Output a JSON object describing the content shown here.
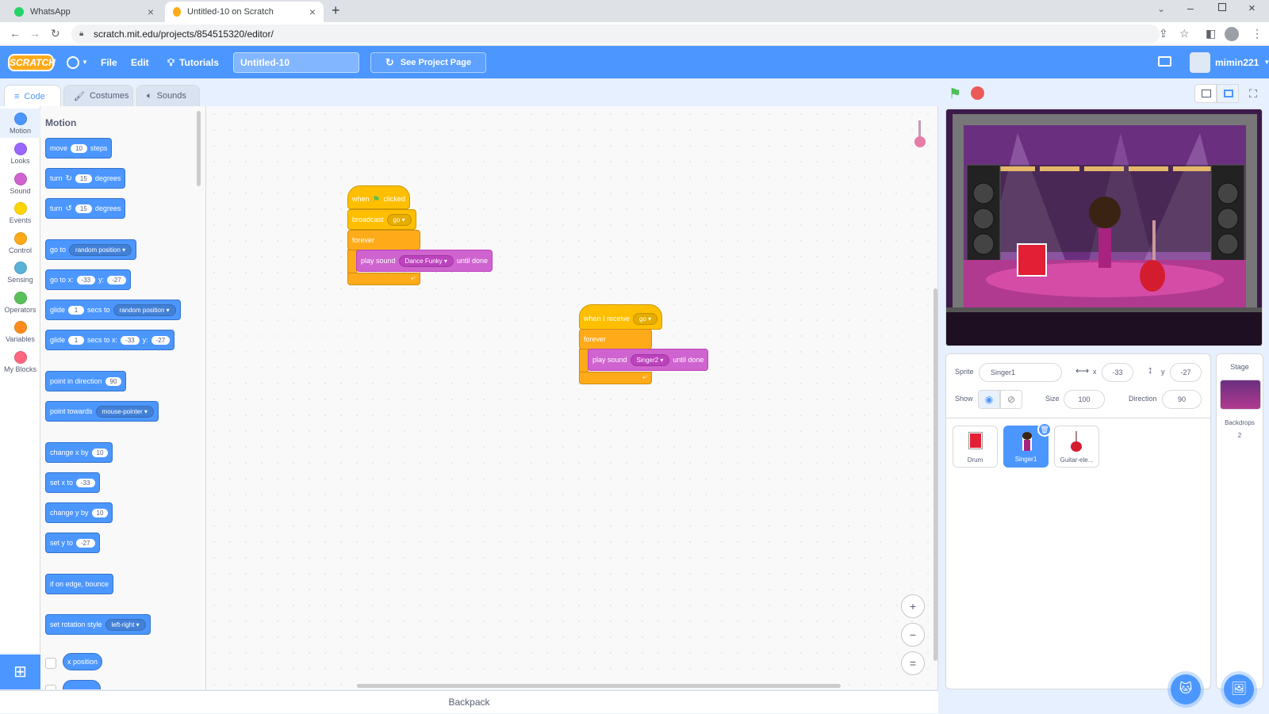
{
  "browser": {
    "tabs": [
      {
        "title": "WhatsApp",
        "active": false
      },
      {
        "title": "Untitled-10 on Scratch",
        "active": true
      }
    ],
    "new_tab": "+",
    "url": "scratch.mit.edu/projects/854515320/editor/"
  },
  "menubar": {
    "logo": "SCRATCH",
    "file": "File",
    "edit": "Edit",
    "tutorials": "Tutorials",
    "project_title": "Untitled-10",
    "see_project_page": "See Project Page",
    "username": "mimin221"
  },
  "editor_tabs": [
    "Code",
    "Costumes",
    "Sounds"
  ],
  "categories": [
    {
      "label": "Motion",
      "color": "#4c97ff"
    },
    {
      "label": "Looks",
      "color": "#9966ff"
    },
    {
      "label": "Sound",
      "color": "#cf63cf"
    },
    {
      "label": "Events",
      "color": "#ffd500"
    },
    {
      "label": "Control",
      "color": "#ffab19"
    },
    {
      "label": "Sensing",
      "color": "#5cb1d6"
    },
    {
      "label": "Operators",
      "color": "#59c059"
    },
    {
      "label": "Variables",
      "color": "#ff8c1a"
    },
    {
      "label": "My Blocks",
      "color": "#ff6680"
    }
  ],
  "palette": {
    "heading": "Motion",
    "move": {
      "pre": "move",
      "val": "10",
      "post": "steps"
    },
    "turn_cw": {
      "pre": "turn",
      "val": "15",
      "post": "degrees"
    },
    "turn_ccw": {
      "pre": "turn",
      "val": "15",
      "post": "degrees"
    },
    "goto": {
      "pre": "go to",
      "dd": "random position"
    },
    "gotoxy": {
      "pre": "go to x:",
      "x": "-33",
      "mid": "y:",
      "y": "-27"
    },
    "glide": {
      "pre": "glide",
      "val": "1",
      "mid": "secs to",
      "dd": "random position"
    },
    "glidexy": {
      "pre": "glide",
      "val": "1",
      "mid": "secs to x:",
      "x": "-33",
      "mid2": "y:",
      "y": "-27"
    },
    "point_dir": {
      "pre": "point in direction",
      "val": "90"
    },
    "point_towards": {
      "pre": "point towards",
      "dd": "mouse-pointer"
    },
    "change_x": {
      "pre": "change x by",
      "val": "10"
    },
    "set_x": {
      "pre": "set x to",
      "val": "-33"
    },
    "change_y": {
      "pre": "change y by",
      "val": "10"
    },
    "set_y": {
      "pre": "set y to",
      "val": "-27"
    },
    "bounce": "if on edge, bounce",
    "rotation": {
      "pre": "set rotation style",
      "dd": "left-right"
    },
    "x_position": "x position"
  },
  "scripts": {
    "script1": {
      "hat": {
        "pre": "when",
        "post": "clicked"
      },
      "broadcast": {
        "pre": "broadcast",
        "dd": "go"
      },
      "forever": "forever",
      "play": {
        "pre": "play sound",
        "dd": "Dance Funky",
        "post": "until done"
      }
    },
    "script2": {
      "hat": {
        "pre": "when I receive",
        "dd": "go"
      },
      "forever": "forever",
      "play": {
        "pre": "play sound",
        "dd": "Singer2",
        "post": "until done"
      }
    }
  },
  "zoom": {
    "in": "+",
    "out": "−",
    "reset": "="
  },
  "backpack": "Backpack",
  "sprite_info": {
    "sprite_label": "Sprite",
    "sprite_name": "Singer1",
    "x_label": "x",
    "x": "-33",
    "y_label": "y",
    "y": "-27",
    "show_label": "Show",
    "size_label": "Size",
    "size": "100",
    "direction_label": "Direction",
    "direction": "90"
  },
  "sprites": [
    {
      "name": "Drum",
      "selected": false
    },
    {
      "name": "Singer1",
      "selected": true
    },
    {
      "name": "Guitar-ele...",
      "selected": false
    }
  ],
  "stage_panel": {
    "title": "Stage",
    "backdrops_label": "Backdrops",
    "backdrops_count": "2"
  }
}
